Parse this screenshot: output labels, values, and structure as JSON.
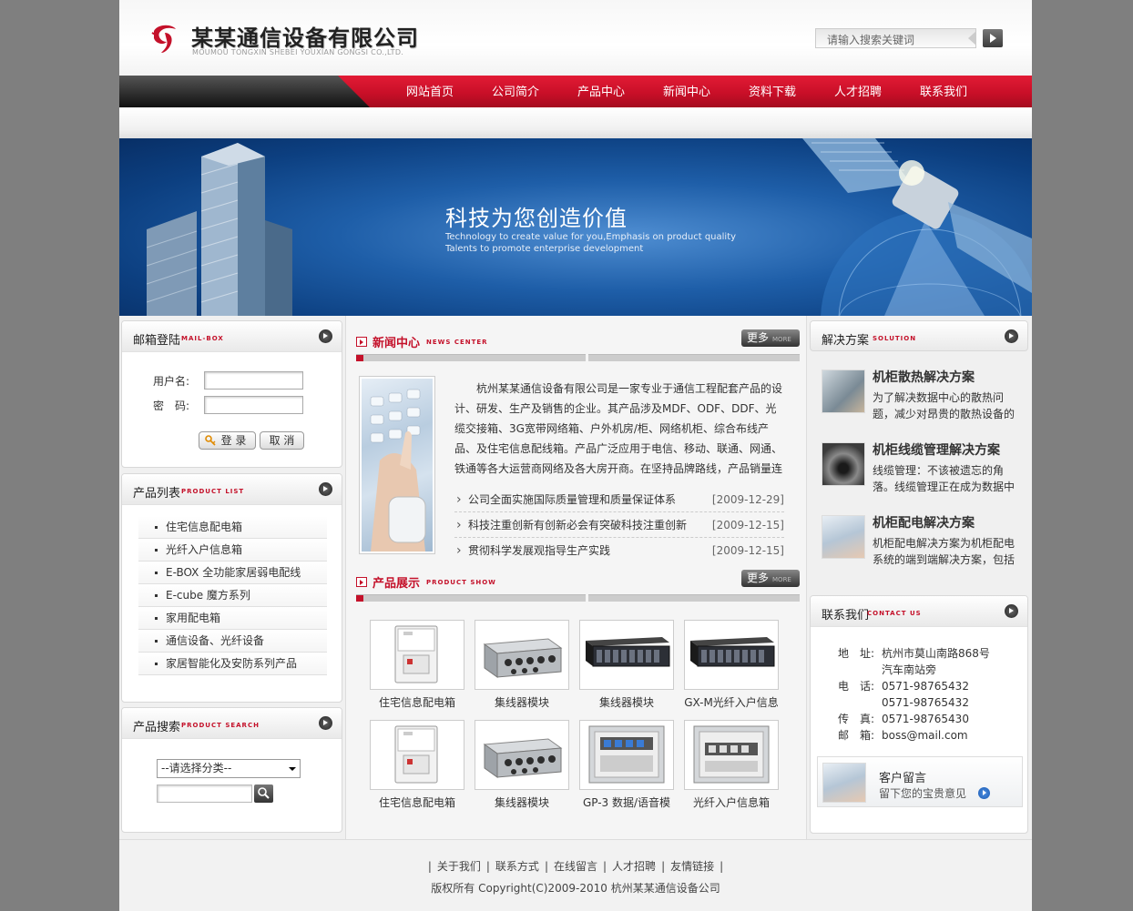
{
  "header": {
    "company_name": "某某通信设备有限公司",
    "company_name_en": "MOUMOU TONGXIN SHEBEI YOUXIAN GONGSI CO.,LTD.",
    "search_placeholder": "请输入搜索关键词"
  },
  "nav": {
    "items": [
      "网站首页",
      "公司简介",
      "产品中心",
      "新闻中心",
      "资料下载",
      "人才招聘",
      "联系我们"
    ]
  },
  "banner": {
    "title": "科技为您创造价值",
    "subtitle_1": "Technology to create value for you,Emphasis on product quality",
    "subtitle_2": "Talents to promote enterprise development"
  },
  "mailbox": {
    "title": "邮箱登陆",
    "title_en": "MAIL-BOX",
    "username_label": "用户名:",
    "password_label": "密　码:",
    "login_label": "登 录",
    "cancel_label": "取 消"
  },
  "product_list": {
    "title": "产品列表",
    "title_en": "PRODUCT LIST",
    "items": [
      "住宅信息配电箱",
      "光纤入户信息箱",
      "E-BOX 全功能家居弱电配线",
      "E-cube 魔方系列",
      "家用配电箱",
      "通信设备、光纤设备",
      "家居智能化及安防系列产品"
    ]
  },
  "product_search": {
    "title": "产品搜索",
    "title_en": "PRODUCT SEARCH",
    "select_value": "--请选择分类--"
  },
  "news": {
    "title": "新闻中心",
    "title_en": "NEWS CENTER",
    "more_label": "更多",
    "more_en": "MORE",
    "intro": "杭州某某通信设备有限公司是一家专业于通信工程配套产品的设计、研发、生产及销售的企业。其产品涉及MDF、ODF、DDF、光缆交接箱、3G宽带网络箱、户外机房/柜、网络机柜、综合布线产品、及住宅信息配线箱。产品广泛应用于电信、移动、联通、网通、铁通等各大运营商网络及各大房开商。在坚持品牌路线，产品销量连年翻番",
    "items": [
      {
        "title": "公司全面实施国际质量管理和质量保证体系",
        "date": "[2009-12-29]"
      },
      {
        "title": "科技注重创新有创新必会有突破科技注重创新有",
        "date": "[2009-12-15]"
      },
      {
        "title": "贯彻科学发展观指导生产实践",
        "date": "[2009-12-15]"
      }
    ]
  },
  "products": {
    "title": "产品展示",
    "title_en": "PRODUCT SHOW",
    "more_label": "更多",
    "more_en": "MORE",
    "items": [
      {
        "caption": "住宅信息配电箱",
        "type": "panel"
      },
      {
        "caption": "集线器模块",
        "type": "hub"
      },
      {
        "caption": "集线器模块",
        "type": "rack"
      },
      {
        "caption": "GX-M光纤入户信息",
        "type": "rack"
      },
      {
        "caption": "住宅信息配电箱",
        "type": "panel"
      },
      {
        "caption": "集线器模块",
        "type": "hub"
      },
      {
        "caption": "GP-3 数据/语音模",
        "type": "patch"
      },
      {
        "caption": "光纤入户信息箱",
        "type": "patch2"
      }
    ]
  },
  "solutions": {
    "title": "解决方案",
    "title_en": "SOLUTION",
    "items": [
      {
        "title": "机柜散热解决方案",
        "desc": "为了解决数据中心的散热问题，减少对昂贵的散热设备的依赖"
      },
      {
        "title": "机柜线缆管理解决方案",
        "desc": "线缆管理：不该被遗忘的角落。线缆管理正在成为数据中心"
      },
      {
        "title": "机柜配电解决方案",
        "desc": "机柜配电解决方案为机柜配电系统的端到端解决方案，包括"
      }
    ]
  },
  "contact": {
    "title": "联系我们",
    "title_en": "CONTACT US",
    "address_label": "地　址:",
    "address_1": "杭州市莫山南路868号",
    "address_2": "汽车南站旁",
    "phone_label": "电　话:",
    "phone_1": "0571-98765432",
    "phone_2": "0571-98765432",
    "fax_label": "传　真:",
    "fax": "0571-98765430",
    "email_label": "邮　箱:",
    "email": "boss@mail.com",
    "message_title": "客户留言",
    "message_sub": "留下您的宝贵意见"
  },
  "footer": {
    "links": [
      "关于我们",
      "联系方式",
      "在线留言",
      "人才招聘",
      "友情链接"
    ],
    "copyright": "版权所有 Copyright(C)2009-2010 杭州某某通信设备公司"
  },
  "colors": {
    "brand_red": "#c4112a",
    "page_bg": "#7f7f7f"
  }
}
